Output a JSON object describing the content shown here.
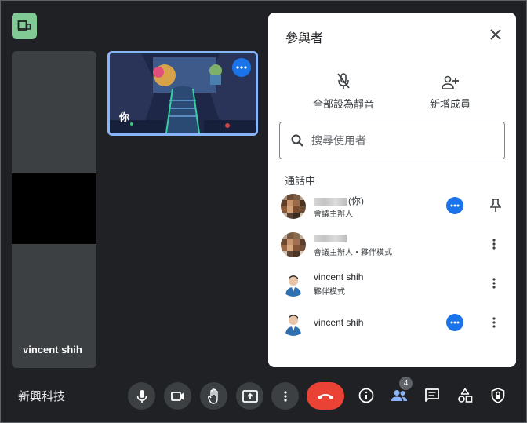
{
  "left_tile": {
    "name": "vincent shih"
  },
  "self_tile": {
    "label": "你"
  },
  "panel": {
    "title": "參與者",
    "mute_all_label": "全部設為靜音",
    "add_people_label": "新增成員",
    "search": {
      "placeholder": "搜尋使用者",
      "value": ""
    },
    "section_label": "通話中",
    "participants": [
      {
        "name": "",
        "suffix": "(你)",
        "role": "會議主辦人"
      },
      {
        "name": "",
        "suffix": "",
        "role": "會議主辦人・夥伴模式"
      },
      {
        "name": "vincent shih",
        "role": "夥伴模式"
      },
      {
        "name": "vincent shih",
        "role": ""
      }
    ]
  },
  "bottom_bar": {
    "meeting_name": "新興科技",
    "participant_count": "4"
  },
  "icons": {
    "companion": "companion-mode-icon",
    "mic": "mic-icon",
    "camera": "videocam-icon",
    "hand": "raise-hand-icon",
    "present": "present-screen-icon",
    "more": "more-vert-icon",
    "end_call": "call-end-icon",
    "info": "info-icon",
    "people": "people-icon",
    "chat": "chat-icon",
    "activities": "activities-icon",
    "host_controls": "host-controls-icon"
  },
  "colors": {
    "accent": "#1a73e8",
    "end_call": "#ea4335",
    "companion": "#81c995",
    "self_border": "#8ab4f8"
  }
}
